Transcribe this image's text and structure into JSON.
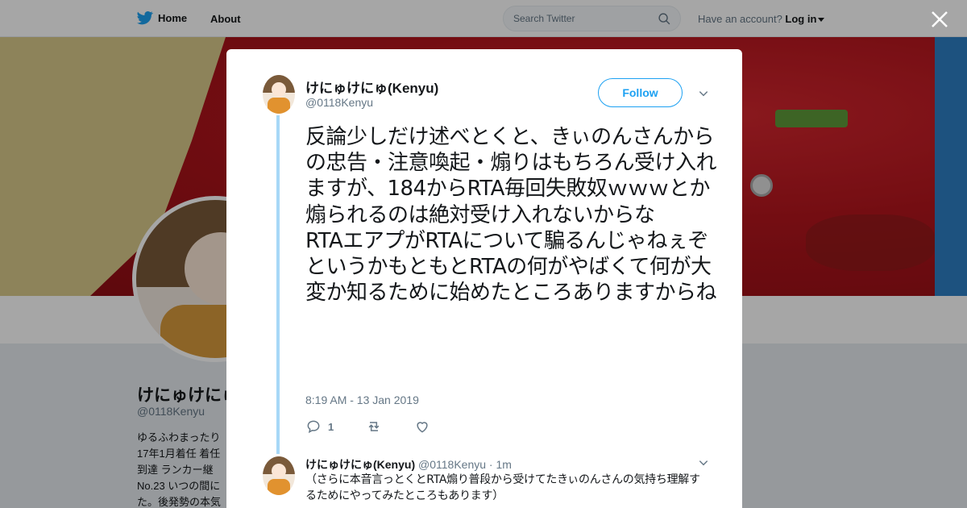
{
  "nav": {
    "home_label": "Home",
    "about_label": "About",
    "search_placeholder": "Search Twitter",
    "account_prompt": "Have an account?",
    "login_label": "Log in"
  },
  "profile": {
    "name": "けにゅけにゅ(Kenyu)",
    "handle": "@0118Kenyu",
    "bio_snippet": "ゆるふわまったり 17年1月着任 着任 到達 ランカー継 No.23 いつの間に た。後発勢の本気"
  },
  "tweet": {
    "name": "けにゅけにゅ(Kenyu)",
    "handle": "@0118Kenyu",
    "follow_label": "Follow",
    "text": "反論少しだけ述べとくと、きぃのんさんからの忠告・注意喚起・煽りはもちろん受け入れますが、184からRTA毎回失敗奴ｗｗｗとか煽られるのは絶対受け入れないからな\nRTAエアプがRTAについて騙るんじゃねぇぞ\nというかもともとRTAの何がやばくて何が大変か知るために始めたところありますからね",
    "timestamp": "8:19 AM - 13 Jan 2019",
    "reply_count": "1"
  },
  "reply": {
    "name": "けにゅけにゅ(Kenyu)",
    "handle": "@0118Kenyu",
    "age": "· 1m",
    "text": "（さらに本音言っとくとRTA煽り普段から受けてたきぃのんさんの気持ち理解するためにやってみたところもあります）"
  },
  "colors": {
    "accent": "#1da1f2",
    "thread_line": "#a7d8f7",
    "text": "#14171a",
    "muted": "#657786"
  },
  "icons": [
    "twitter-bird-icon",
    "search-icon",
    "close-icon",
    "chevron-down-icon",
    "reply-icon",
    "retweet-icon",
    "like-icon"
  ]
}
